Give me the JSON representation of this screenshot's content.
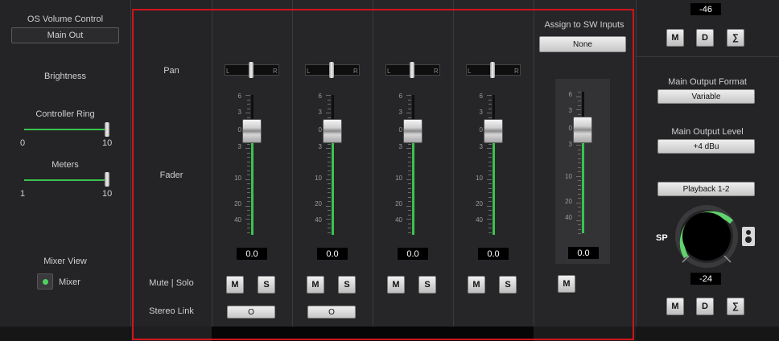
{
  "left": {
    "os_volume_label": "OS Volume Control",
    "os_volume_value": "Main Out",
    "brightness_label": "Brightness",
    "controller_ring_label": "Controller Ring",
    "controller_ring_min": "0",
    "controller_ring_max": "10",
    "controller_ring_level": 1.0,
    "meters_label": "Meters",
    "meters_min": "1",
    "meters_max": "10",
    "meters_level": 1.0,
    "mixer_view_label": "Mixer View",
    "mixer_option": "Mixer"
  },
  "mixer": {
    "row_pan": "Pan",
    "row_fader": "Fader",
    "row_mute_solo": "Mute | Solo",
    "row_stereo_link": "Stereo Link",
    "pan_l": "L",
    "pan_r": "R",
    "scale": [
      "6",
      "3",
      "0",
      "3",
      "10",
      "20",
      "40"
    ],
    "mute_label": "M",
    "solo_label": "S",
    "link_label": "O",
    "channels": [
      {
        "value": "0.0",
        "level_db": 0
      },
      {
        "value": "0.0",
        "level_db": 0
      },
      {
        "value": "0.0",
        "level_db": 0
      },
      {
        "value": "0.0",
        "level_db": 0
      }
    ],
    "sw_assign_label": "Assign to SW Inputs",
    "sw_assign_value": "None",
    "sw_fader_value": "0.0"
  },
  "right": {
    "top_value": "-46",
    "m_label": "M",
    "d_label": "D",
    "sum_label": "∑",
    "main_output_format_label": "Main Output Format",
    "main_output_format_value": "Variable",
    "main_output_level_label": "Main Output Level",
    "main_output_level_value": "+4 dBu",
    "playback_value": "Playback 1-2",
    "sp_label": "SP",
    "knob_value": "-24"
  },
  "colors": {
    "accent_green": "#3cc24f",
    "selection_red": "#d0141c"
  }
}
